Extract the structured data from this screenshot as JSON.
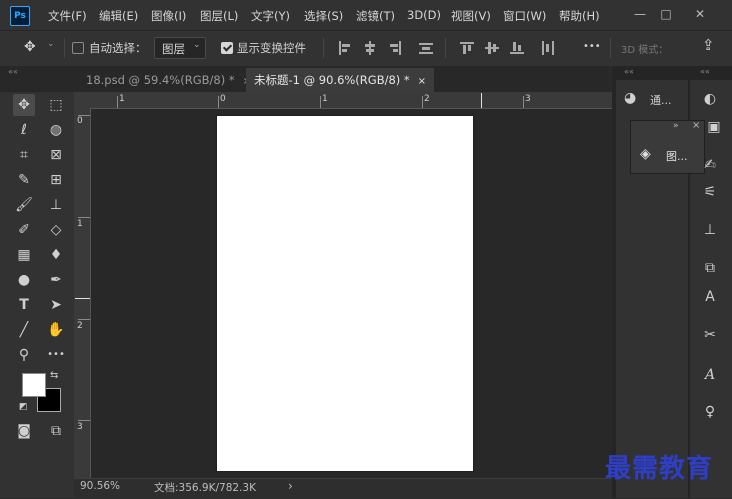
{
  "app": {
    "logo": "Ps"
  },
  "menu": [
    "文件(F)",
    "编辑(E)",
    "图像(I)",
    "图层(L)",
    "文字(Y)",
    "选择(S)",
    "滤镜(T)",
    "3D(D)",
    "视图(V)",
    "窗口(W)",
    "帮助(H)"
  ],
  "window_controls": {
    "minimize": "—",
    "maximize": "□",
    "close": "✕"
  },
  "options": {
    "move_icon": "✥",
    "auto_select_label": "自动选择：",
    "auto_select_checked": false,
    "target_value": "图层",
    "show_transform_label": "显示变换控件",
    "show_transform_checked": true,
    "more": "•••",
    "mode_3d": "3D 模式：",
    "share_icon": "share-icon"
  },
  "tabs": [
    {
      "label": "18.psd @ 59.4%(RGB/8) *",
      "active": false
    },
    {
      "label": "未标题-1 @ 90.6%(RGB/8) *",
      "active": true
    }
  ],
  "tab_close": "×",
  "rulers": {
    "top": [
      "1",
      "0",
      "1",
      "2",
      "3"
    ],
    "left": [
      "0",
      "1",
      "2",
      "3"
    ]
  },
  "status": {
    "zoom": "90.56%",
    "doc_info": "文档:356.9K/782.3K",
    "arrow": "›"
  },
  "panels": {
    "channels_label": "通...",
    "layers_label": "图...",
    "expand": "»",
    "close": "×",
    "collapse": "««"
  },
  "watermark": "最需教育",
  "colors": {
    "accent": "#31a8ff",
    "canvas": "#ffffff",
    "foreground": "#ffffff",
    "background": "#000000"
  }
}
